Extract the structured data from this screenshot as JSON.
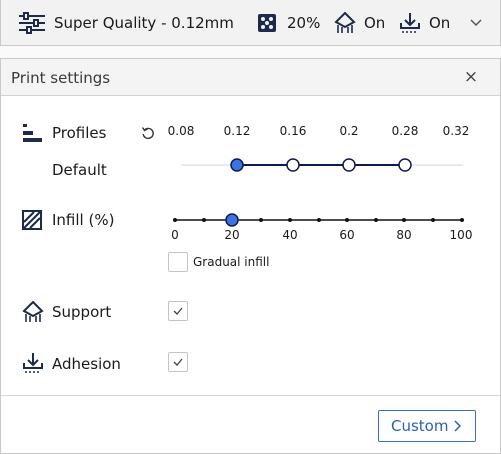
{
  "topbar": {
    "profile_label": "Super Quality - 0.12mm",
    "infill_value": "20%",
    "support_value": "On",
    "adhesion_value": "On"
  },
  "panel": {
    "title": "Print settings",
    "close_glyph": "×",
    "profiles": {
      "label": "Profiles",
      "profile_name": "Default",
      "layer_heights": [
        "0.08",
        "0.12",
        "0.16",
        "0.2",
        "0.28",
        "0.32"
      ],
      "selected": "0.12",
      "available": [
        "0.12",
        "0.16",
        "0.2",
        "0.28"
      ]
    },
    "infill": {
      "label": "Infill (%)",
      "ticks": [
        "0",
        "20",
        "40",
        "60",
        "80",
        "100"
      ],
      "value": 20,
      "gradual_label": "Gradual infill",
      "gradual_checked": false
    },
    "support": {
      "label": "Support",
      "checked": true
    },
    "adhesion": {
      "label": "Adhesion",
      "checked": true
    },
    "custom_button": "Custom"
  },
  "colors": {
    "accent": "#3b74e0",
    "track": "#0e1a4d",
    "border": "#c8c8c8"
  }
}
